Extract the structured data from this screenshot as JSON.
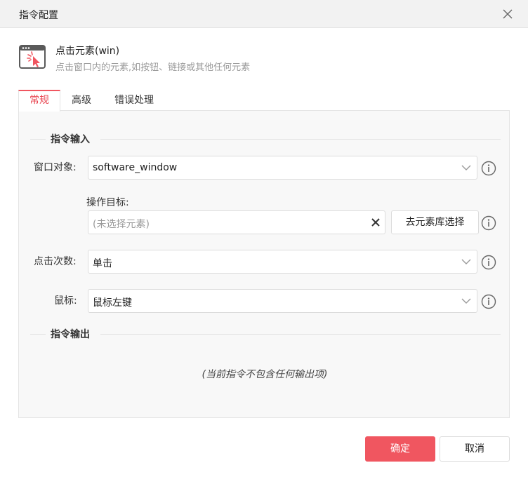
{
  "dialog": {
    "title": "指令配置"
  },
  "command": {
    "name": "点击元素(win)",
    "description": "点击窗口内的元素,如按钮、链接或其他任何元素"
  },
  "tabs": [
    {
      "label": "常规",
      "active": true
    },
    {
      "label": "高级",
      "active": false
    },
    {
      "label": "错误处理",
      "active": false
    }
  ],
  "sections": {
    "input": "指令输入",
    "output": "指令输出"
  },
  "fields": {
    "window": {
      "label": "窗口对象:",
      "value": "software_window"
    },
    "target": {
      "label": "操作目标:",
      "placeholder": "(未选择元素)",
      "library_button": "去元素库选择"
    },
    "click_count": {
      "label": "点击次数:",
      "value": "单击"
    },
    "mouse": {
      "label": "鼠标:",
      "value": "鼠标左键"
    }
  },
  "output": {
    "empty_text": "(当前指令不包含任何输出项)"
  },
  "footer": {
    "confirm": "确定",
    "cancel": "取消"
  },
  "colors": {
    "accent": "#f05660",
    "panel_bg": "#f8f8f8"
  }
}
